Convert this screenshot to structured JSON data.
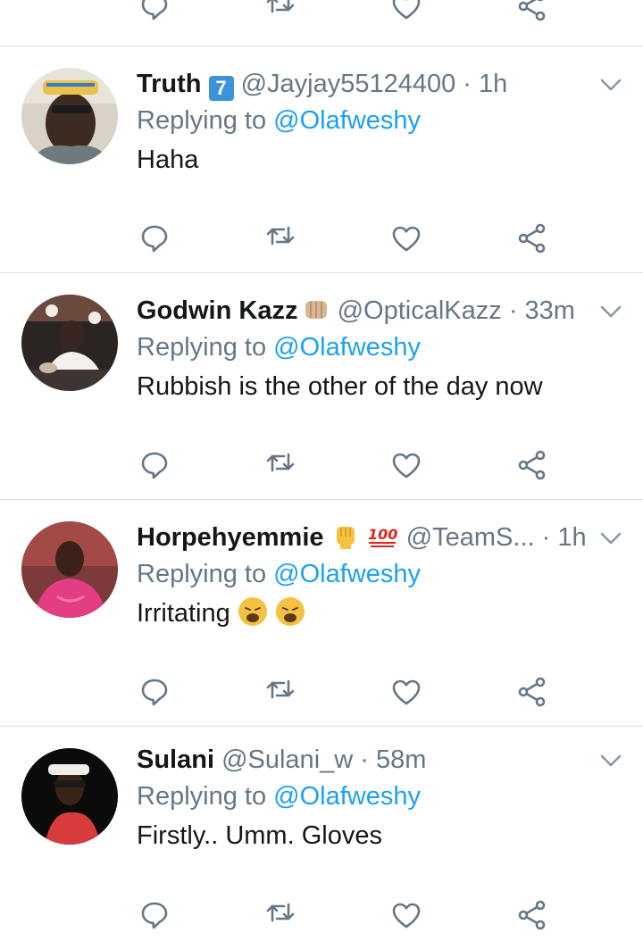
{
  "tweets": [
    {
      "name": "Truth",
      "badge": "7",
      "handle": "@Jayjay55124400",
      "time": "· 1h",
      "replying_prefix": "Replying to",
      "replying_to": "@Olafweshy",
      "text": "Haha"
    },
    {
      "name": "Godwin Kazz",
      "name_emoji": "fist-bump",
      "handle": "@OpticalKazz",
      "time": "· 33m",
      "replying_prefix": "Replying to",
      "replying_to": "@Olafweshy",
      "text": "Rubbish is the other of the day now"
    },
    {
      "name": "Horpehyemmie",
      "name_emoji": "raised-fist 100",
      "handle": "@TeamS...",
      "time": "· 1h",
      "replying_prefix": "Replying to",
      "replying_to": "@Olafweshy",
      "text": "Irritating",
      "text_emoji": "weary-face weary-face"
    },
    {
      "name": "Sulani",
      "handle": "@Sulani_w",
      "time": "· 58m",
      "replying_prefix": "Replying to",
      "replying_to": "@Olafweshy",
      "text": "Firstly.. Umm. Gloves"
    }
  ],
  "icons": {
    "reply": "reply-icon",
    "retweet": "retweet-icon",
    "like": "like-icon",
    "share": "share-icon",
    "caret": "chevron-down-icon"
  },
  "colors": {
    "mention": "#1da1f2",
    "meta": "#657786",
    "icon": "#657786",
    "divider": "#dfe3e7"
  }
}
